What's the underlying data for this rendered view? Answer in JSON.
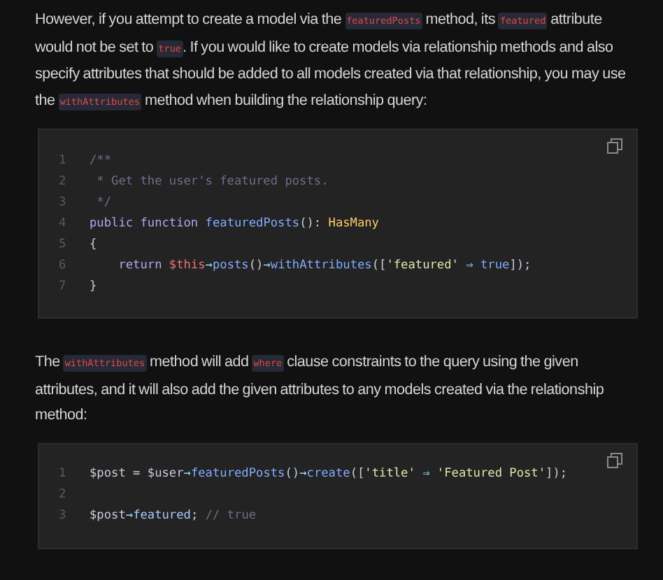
{
  "blocks": [
    {
      "kind": "paragraph",
      "segments": [
        {
          "kind": "text",
          "text": "However, if you attempt to create a model via the "
        },
        {
          "kind": "code",
          "text": "featuredPosts"
        },
        {
          "kind": "text",
          "text": " method, its "
        },
        {
          "kind": "code",
          "text": "featured"
        },
        {
          "kind": "text",
          "text": " attribute would not be set to "
        },
        {
          "kind": "code",
          "text": "true"
        },
        {
          "kind": "text",
          "text": ". If you would like to create models via relationship methods and also specify attributes that should be added to all models created via that relationship, you may use the "
        },
        {
          "kind": "code",
          "text": "withAttributes"
        },
        {
          "kind": "text",
          "text": " method when building the relationship query:"
        }
      ]
    },
    {
      "kind": "code",
      "lines": [
        {
          "number": "1",
          "tokens": [
            {
              "kind": "comment",
              "text": "/**"
            }
          ]
        },
        {
          "number": "2",
          "tokens": [
            {
              "kind": "comment",
              "text": " * Get the user's featured posts."
            }
          ]
        },
        {
          "number": "3",
          "tokens": [
            {
              "kind": "comment",
              "text": " */"
            }
          ]
        },
        {
          "number": "4",
          "tokens": [
            {
              "kind": "keyword",
              "text": "public function "
            },
            {
              "kind": "function",
              "text": "featuredPosts"
            },
            {
              "kind": "plain",
              "text": "(): "
            },
            {
              "kind": "type",
              "text": "HasMany"
            }
          ]
        },
        {
          "number": "5",
          "tokens": [
            {
              "kind": "plain",
              "text": "{"
            }
          ]
        },
        {
          "number": "6",
          "tokens": [
            {
              "kind": "keyword",
              "text": "    return "
            },
            {
              "kind": "variable",
              "text": "$this"
            },
            {
              "kind": "operator",
              "text": "→"
            },
            {
              "kind": "function",
              "text": "posts"
            },
            {
              "kind": "plain",
              "text": "()"
            },
            {
              "kind": "operator",
              "text": "→"
            },
            {
              "kind": "function",
              "text": "withAttributes"
            },
            {
              "kind": "plain",
              "text": "(["
            },
            {
              "kind": "string",
              "text": "'featured'"
            },
            {
              "kind": "operator",
              "text": " ⇒ "
            },
            {
              "kind": "constant",
              "text": "true"
            },
            {
              "kind": "plain",
              "text": "]);"
            }
          ]
        },
        {
          "number": "7",
          "tokens": [
            {
              "kind": "plain",
              "text": "}"
            }
          ]
        }
      ]
    },
    {
      "kind": "paragraph",
      "segments": [
        {
          "kind": "text",
          "text": "The "
        },
        {
          "kind": "code",
          "text": "withAttributes"
        },
        {
          "kind": "text",
          "text": " method will add "
        },
        {
          "kind": "code",
          "text": "where"
        },
        {
          "kind": "text",
          "text": " clause constraints to the query using the given attributes, and it will also add the given attributes to any models created via the relationship method:"
        }
      ]
    },
    {
      "kind": "code",
      "lines": [
        {
          "number": "1",
          "tokens": [
            {
              "kind": "plain",
              "text": "$post = $user"
            },
            {
              "kind": "operator",
              "text": "→"
            },
            {
              "kind": "function",
              "text": "featuredPosts"
            },
            {
              "kind": "plain",
              "text": "()"
            },
            {
              "kind": "operator",
              "text": "→"
            },
            {
              "kind": "function",
              "text": "create"
            },
            {
              "kind": "plain",
              "text": "(["
            },
            {
              "kind": "string",
              "text": "'title'"
            },
            {
              "kind": "operator",
              "text": " ⇒ "
            },
            {
              "kind": "string",
              "text": "'Featured Post'"
            },
            {
              "kind": "plain",
              "text": "]);"
            }
          ]
        },
        {
          "number": "2"
        },
        {
          "number": "3",
          "tokens": [
            {
              "kind": "plain",
              "text": "$post"
            },
            {
              "kind": "operator",
              "text": "→"
            },
            {
              "kind": "property",
              "text": "featured"
            },
            {
              "kind": "plain",
              "text": "; "
            },
            {
              "kind": "comment",
              "text": "// true"
            }
          ]
        }
      ]
    }
  ]
}
